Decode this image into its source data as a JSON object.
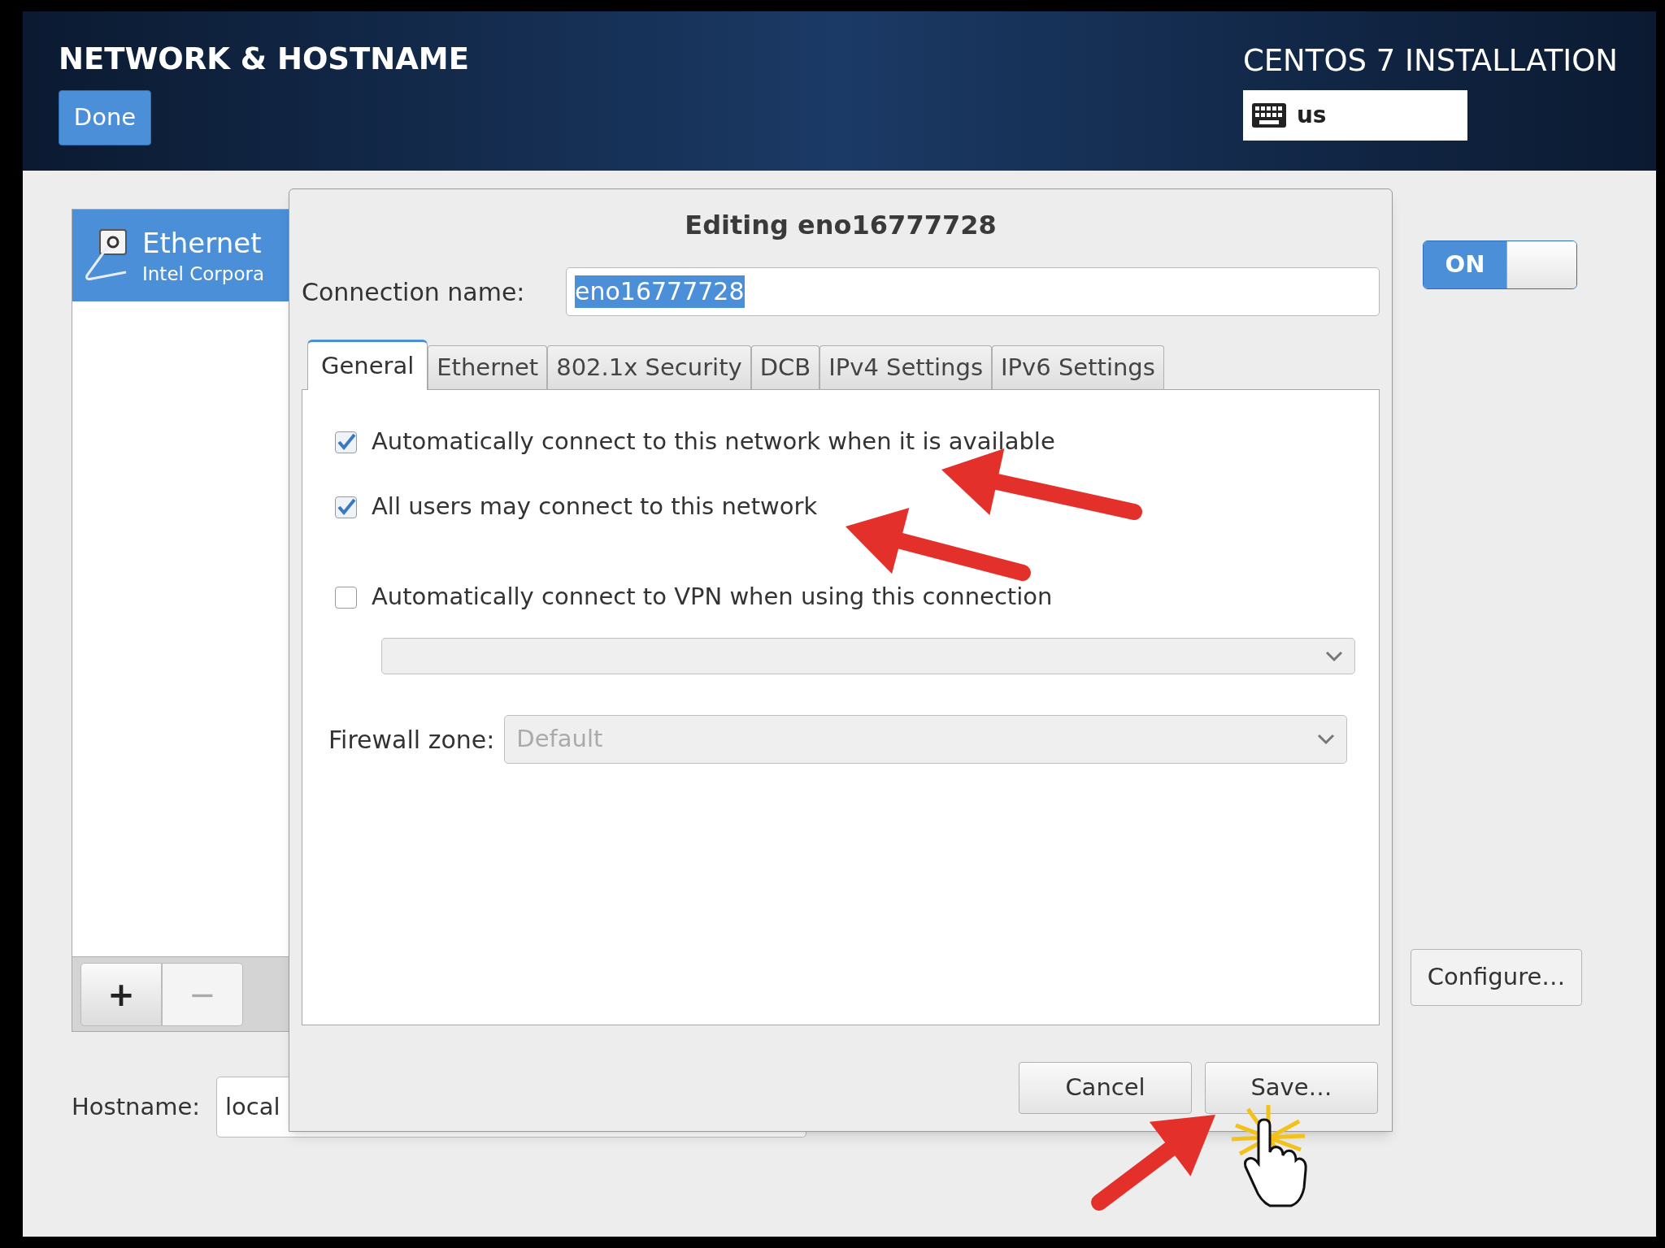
{
  "header": {
    "title": "NETWORK & HOSTNAME",
    "done_button": "Done",
    "product": "CENTOS 7 INSTALLATION",
    "keyboard_layout": "us"
  },
  "connections": [
    {
      "name": "Ethernet",
      "detail": "Intel Corpora",
      "selected": true
    }
  ],
  "list_buttons": [
    {
      "label": "+",
      "disabled": false
    },
    {
      "label": "−",
      "disabled": true
    }
  ],
  "hostname": {
    "label": "Hostname:",
    "value": "local"
  },
  "switch": {
    "label": "ON",
    "on": true
  },
  "configure_button": "Configure…",
  "dialog": {
    "title": "Editing eno16777728",
    "connection_name_label": "Connection name:",
    "connection_name": {
      "value": "eno16777728",
      "highlighted": true
    },
    "tabs": [
      {
        "label": "General",
        "selected": true
      },
      {
        "label": "Ethernet",
        "selected": false
      },
      {
        "label": "802.1x Security",
        "selected": false
      },
      {
        "label": "DCB",
        "selected": false
      },
      {
        "label": "IPv4 Settings",
        "selected": false
      },
      {
        "label": "IPv6 Settings",
        "selected": false
      }
    ],
    "options": [
      {
        "label": "Automatically connect to this network when it is available",
        "checked": true
      },
      {
        "label": "All users may connect to this network",
        "checked": true
      },
      {
        "label": "Automatically connect to VPN when using this connection",
        "checked": false
      }
    ],
    "vpn_select": {
      "disabled": true
    },
    "firewall": {
      "label": "Firewall zone:",
      "value": "Default",
      "disabled": true
    },
    "buttons": [
      "Cancel",
      "Save…"
    ]
  }
}
